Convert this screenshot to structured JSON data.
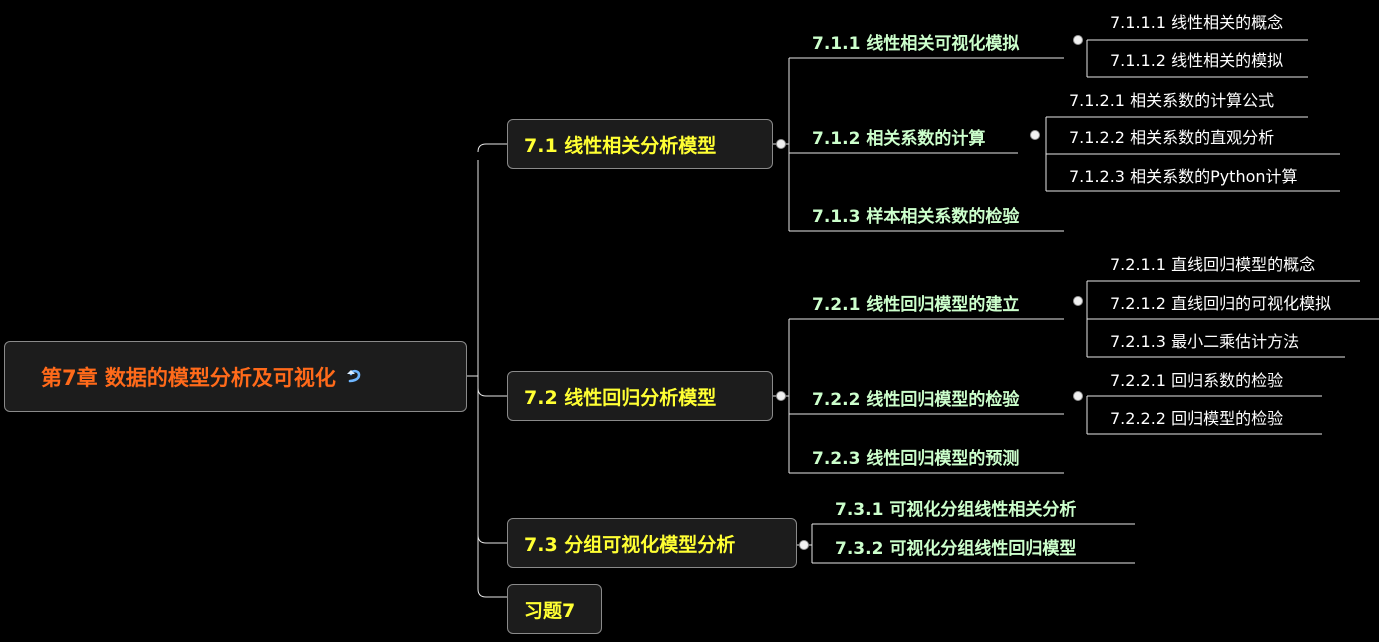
{
  "root": {
    "label": "第7章  数据的模型分析及可视化",
    "icon": "u-turn-arrow-icon"
  },
  "sections": [
    {
      "label": "7.1  线性相关分析模型",
      "subsections": [
        {
          "label": "7.1.1  线性相关可视化模拟",
          "children": [
            "7.1.1.1 线性相关的概念",
            "7.1.1.2 线性相关的模拟"
          ]
        },
        {
          "label": "7.1.2  相关系数的计算",
          "children": [
            "7.1.2.1 相关系数的计算公式",
            "7.1.2.2 相关系数的直观分析",
            "7.1.2.3 相关系数的Python计算"
          ]
        },
        {
          "label": "7.1.3  样本相关系数的检验",
          "children": []
        }
      ]
    },
    {
      "label": "7.2  线性回归分析模型",
      "subsections": [
        {
          "label": "7.2.1  线性回归模型的建立",
          "children": [
            "7.2.1.1  直线回归模型的概念",
            "7.2.1.2  直线回归的可视化模拟",
            "7.2.1.3  最小二乘估计方法"
          ]
        },
        {
          "label": "7.2.2  线性回归模型的检验",
          "children": [
            "7.2.2.1 回归系数的检验",
            "7.2.2.2 回归模型的检验"
          ]
        },
        {
          "label": "7.2.3  线性回归模型的预测",
          "children": []
        }
      ]
    },
    {
      "label": "7.3  分组可视化模型分析",
      "subsections": [
        {
          "label": "7.3.1  可视化分组线性相关分析",
          "children": []
        },
        {
          "label": "7.3.2  可视化分组线性回归模型",
          "children": []
        }
      ]
    },
    {
      "label": "习题7",
      "subsections": []
    }
  ]
}
